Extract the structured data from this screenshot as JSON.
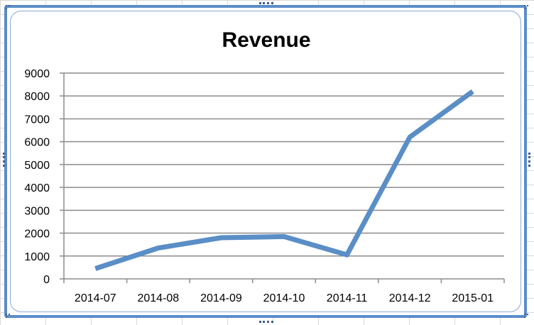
{
  "colors": {
    "line": "#5a8ec6",
    "gridline": "#8c8c8c",
    "axis": "#8c8c8c",
    "frame": "#5b8cc9"
  },
  "chart_data": {
    "type": "line",
    "title": "Revenue",
    "xlabel": "",
    "ylabel": "",
    "categories": [
      "2014-07",
      "2014-08",
      "2014-09",
      "2014-10",
      "2014-11",
      "2014-12",
      "2015-01"
    ],
    "series": [
      {
        "values": [
          450,
          1350,
          1800,
          1850,
          1050,
          6200,
          8200
        ]
      }
    ],
    "ylim": [
      0,
      9000
    ],
    "yticks": [
      0,
      1000,
      2000,
      3000,
      4000,
      5000,
      6000,
      7000,
      8000,
      9000
    ],
    "grid": true,
    "legend": "none"
  }
}
